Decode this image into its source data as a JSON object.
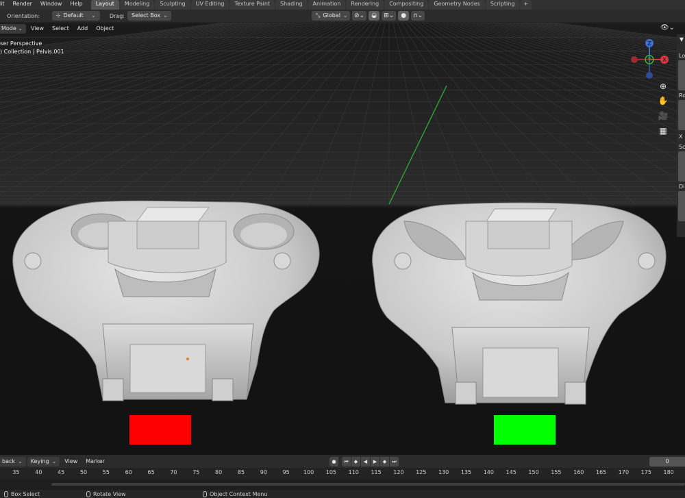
{
  "menu": [
    "dit",
    "Render",
    "Window",
    "Help"
  ],
  "workspace_tabs": [
    {
      "label": "Layout",
      "active": true
    },
    {
      "label": "Modeling"
    },
    {
      "label": "Sculpting"
    },
    {
      "label": "UV Editing"
    },
    {
      "label": "Texture Paint"
    },
    {
      "label": "Shading"
    },
    {
      "label": "Animation"
    },
    {
      "label": "Rendering"
    },
    {
      "label": "Compositing"
    },
    {
      "label": "Geometry Nodes"
    },
    {
      "label": "Scripting"
    }
  ],
  "add_tab_label": "+",
  "tool_settings": {
    "orientation_label": "Orientation:",
    "orientation_value": "Default",
    "drag_label": "Drag:",
    "drag_value": "Select Box",
    "transform_space": "Global"
  },
  "viewport_header": {
    "mode": "Mode",
    "view": "View",
    "select": "Select",
    "add": "Add",
    "object": "Object"
  },
  "overlay": {
    "perspective": "ser Perspective",
    "collection": ") Collection | Pelvis.001"
  },
  "gizmo": {
    "z": "Z",
    "y": "Y",
    "x": "X"
  },
  "npanel": {
    "lo": "Lo",
    "ro": "Ro",
    "x": "X",
    "sc": "Sc",
    "di": "Di"
  },
  "swatches": {
    "left_color": "#ff0000",
    "right_color": "#00ff00"
  },
  "timeline_header": {
    "playback": "back",
    "keying": "Keying",
    "view": "View",
    "marker": "Marker",
    "current_frame": "0"
  },
  "ruler_ticks": [
    "35",
    "40",
    "45",
    "50",
    "55",
    "60",
    "65",
    "70",
    "75",
    "80",
    "85",
    "90",
    "95",
    "100",
    "105",
    "110",
    "115",
    "120",
    "125",
    "130",
    "135",
    "140",
    "145",
    "150",
    "155",
    "160",
    "165",
    "170",
    "175",
    "180"
  ],
  "statusbar": {
    "box_select": "Box Select",
    "rotate_view": "Rotate View",
    "object_context_menu": "Object Context Menu"
  }
}
